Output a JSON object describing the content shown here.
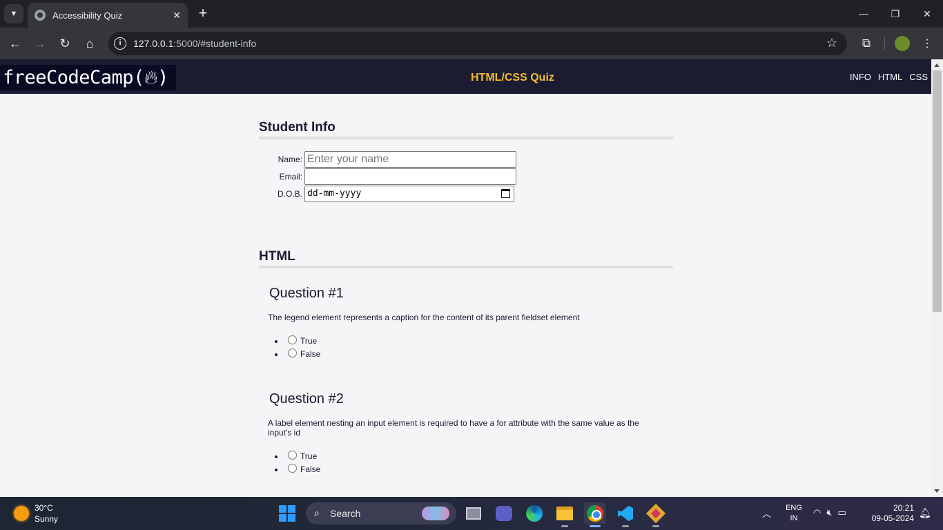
{
  "browser": {
    "tab_title": "Accessibility Quiz",
    "url_host": "127.0.0.1",
    "url_rest": ":5000/#student-info",
    "window_controls": {
      "minimize": "—",
      "restore": "❐",
      "close": "✕"
    }
  },
  "site": {
    "logo": "freeCodeCamp(",
    "logo_end": ")",
    "title": "HTML/CSS Quiz",
    "nav": [
      "INFO",
      "HTML",
      "CSS"
    ]
  },
  "student_info": {
    "heading": "Student Info",
    "name_label": "Name:",
    "name_placeholder": "Enter your name",
    "email_label": "Email:",
    "email_value": "",
    "dob_label": "D.O.B.",
    "dob_placeholder": "dd-mm-yyyy"
  },
  "html_section": {
    "heading": "HTML",
    "questions": [
      {
        "title": "Question #1",
        "text": "The legend element represents a caption for the content of its parent fieldset element",
        "options": [
          "True",
          "False"
        ]
      },
      {
        "title": "Question #2",
        "text": "A label element nesting an input element is required to have a for attribute with the same value as the input's id",
        "options": [
          "True",
          "False"
        ]
      }
    ]
  },
  "taskbar": {
    "weather_temp": "30°C",
    "weather_desc": "Sunny",
    "search_label": "Search",
    "lang_line1": "ENG",
    "lang_line2": "IN",
    "time": "20:21",
    "date": "09-05-2024"
  },
  "colors": {
    "site_header_bg": "#1b1b32",
    "site_title": "#f1be32",
    "page_bg": "#f4f5f6"
  }
}
